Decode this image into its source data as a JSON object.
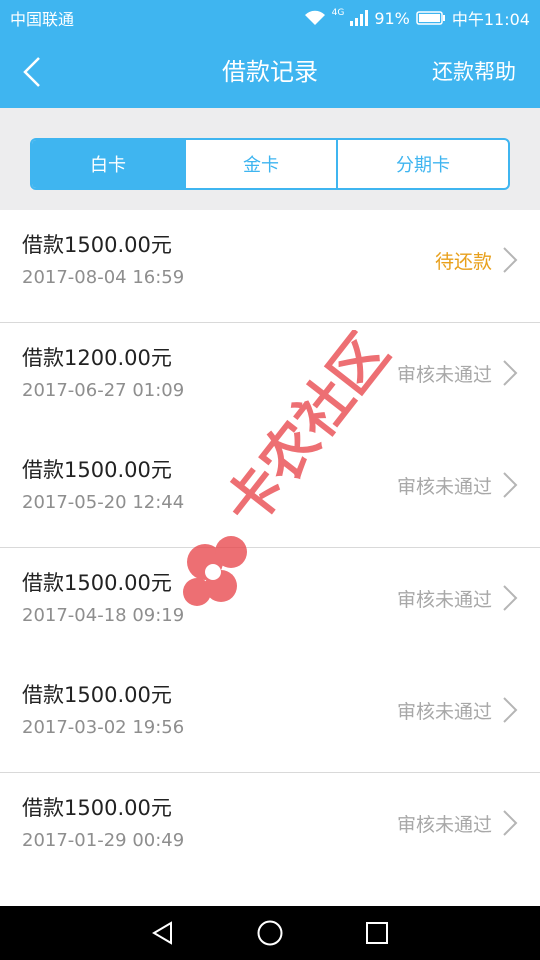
{
  "statusbar": {
    "carrier": "中国联通",
    "network": "4G",
    "battery": "91%",
    "time": "中午11:04"
  },
  "header": {
    "title": "借款记录",
    "help": "还款帮助"
  },
  "tabs": [
    {
      "label": "白卡",
      "active": true
    },
    {
      "label": "金卡",
      "active": false
    },
    {
      "label": "分期卡",
      "active": false
    }
  ],
  "records": [
    {
      "amount": "借款1500.00元",
      "date": "2017-08-04 16:59",
      "status": "待还款"
    },
    {
      "amount": "借款1200.00元",
      "date": "2017-06-27 01:09",
      "status": "审核未通过"
    },
    {
      "amount": "借款1500.00元",
      "date": "2017-05-20 12:44",
      "status": "审核未通过"
    },
    {
      "amount": "借款1500.00元",
      "date": "2017-04-18 09:19",
      "status": "审核未通过"
    },
    {
      "amount": "借款1500.00元",
      "date": "2017-03-02 19:56",
      "status": "审核未通过"
    },
    {
      "amount": "借款1500.00元",
      "date": "2017-01-29 00:49",
      "status": "审核未通过"
    }
  ],
  "watermark": {
    "text": "卡农社区",
    "color": "#e8474c"
  },
  "colors": {
    "primary": "#3fb5f0",
    "pending": "#e8a01c",
    "muted": "#a8a8a8"
  }
}
